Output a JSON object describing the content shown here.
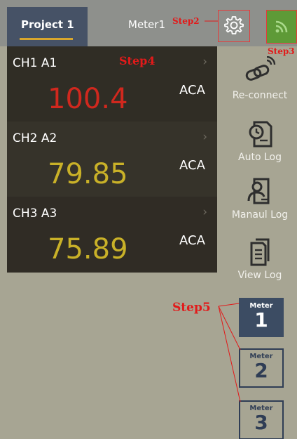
{
  "header": {
    "project_tab": "Project 1",
    "meter_title": "Meter1"
  },
  "channels": [
    {
      "label": "CH1 A1",
      "value": "100.4",
      "unit": "ACA",
      "value_color": "#d0281e"
    },
    {
      "label": "CH2 A2",
      "value": "79.85",
      "unit": "ACA",
      "value_color": "#c9b128"
    },
    {
      "label": "CH3 A3",
      "value": "75.89",
      "unit": "ACA",
      "value_color": "#c9b128"
    }
  ],
  "actions": {
    "reconnect": "Re-connect",
    "auto_log": "Auto Log",
    "manual_log": "Manaul Log",
    "view_log": "View Log"
  },
  "meters": [
    {
      "label": "Meter",
      "number": "1",
      "selected": true
    },
    {
      "label": "Meter",
      "number": "2",
      "selected": false
    },
    {
      "label": "Meter",
      "number": "3",
      "selected": false
    }
  ],
  "annotations": {
    "step2": "Step2",
    "step3": "Step3",
    "step4": "Step4",
    "step5": "Step5"
  },
  "icons": {
    "settings": "gear-icon",
    "signal": "wifi-icon",
    "reconnect": "reconnect-icon",
    "auto_log": "clock-document-icon",
    "manual_log": "user-document-icon",
    "view_log": "document-icon",
    "chevron": "chevron-right-icon"
  },
  "colors": {
    "background": "#a7a593",
    "panel": "#302c25",
    "tab_active": "#465266",
    "tab_underline": "#d8a62d",
    "signal_green": "#5e9a37",
    "annotation_red": "#e21a1a",
    "meter_selected": "#3c4c63"
  }
}
